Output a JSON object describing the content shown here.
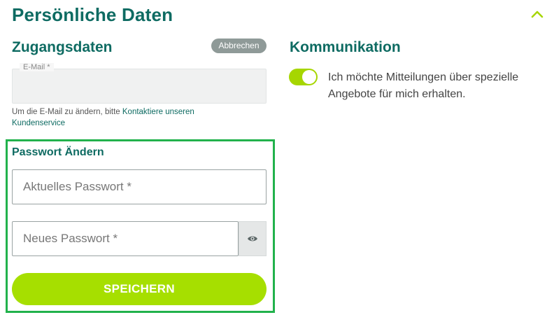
{
  "header": {
    "title": "Persönliche Daten",
    "collapse_icon": "chevron-up-icon"
  },
  "access": {
    "title": "Zugangsdaten",
    "cancel_label": "Abbrechen",
    "email": {
      "label": "E-Mail *",
      "value": ""
    },
    "hint_prefix": "Um die E-Mail zu ändern, bitte ",
    "hint_link": "Kontaktiere unseren Kundenservice"
  },
  "communication": {
    "title": "Kommunikation",
    "toggle_on": true,
    "toggle_text": "Ich möchte Mitteilungen über spezielle Angebote für mich erhalten."
  },
  "password": {
    "title": "Passwort Ändern",
    "current_placeholder": "Aktuelles Passwort *",
    "new_placeholder": "Neues Passwort *",
    "show_icon": "eye-icon",
    "save_label": "SPEICHERN"
  },
  "colors": {
    "brand": "#0e6b62",
    "accent": "#a6df00",
    "highlight_border": "#22b24c"
  }
}
